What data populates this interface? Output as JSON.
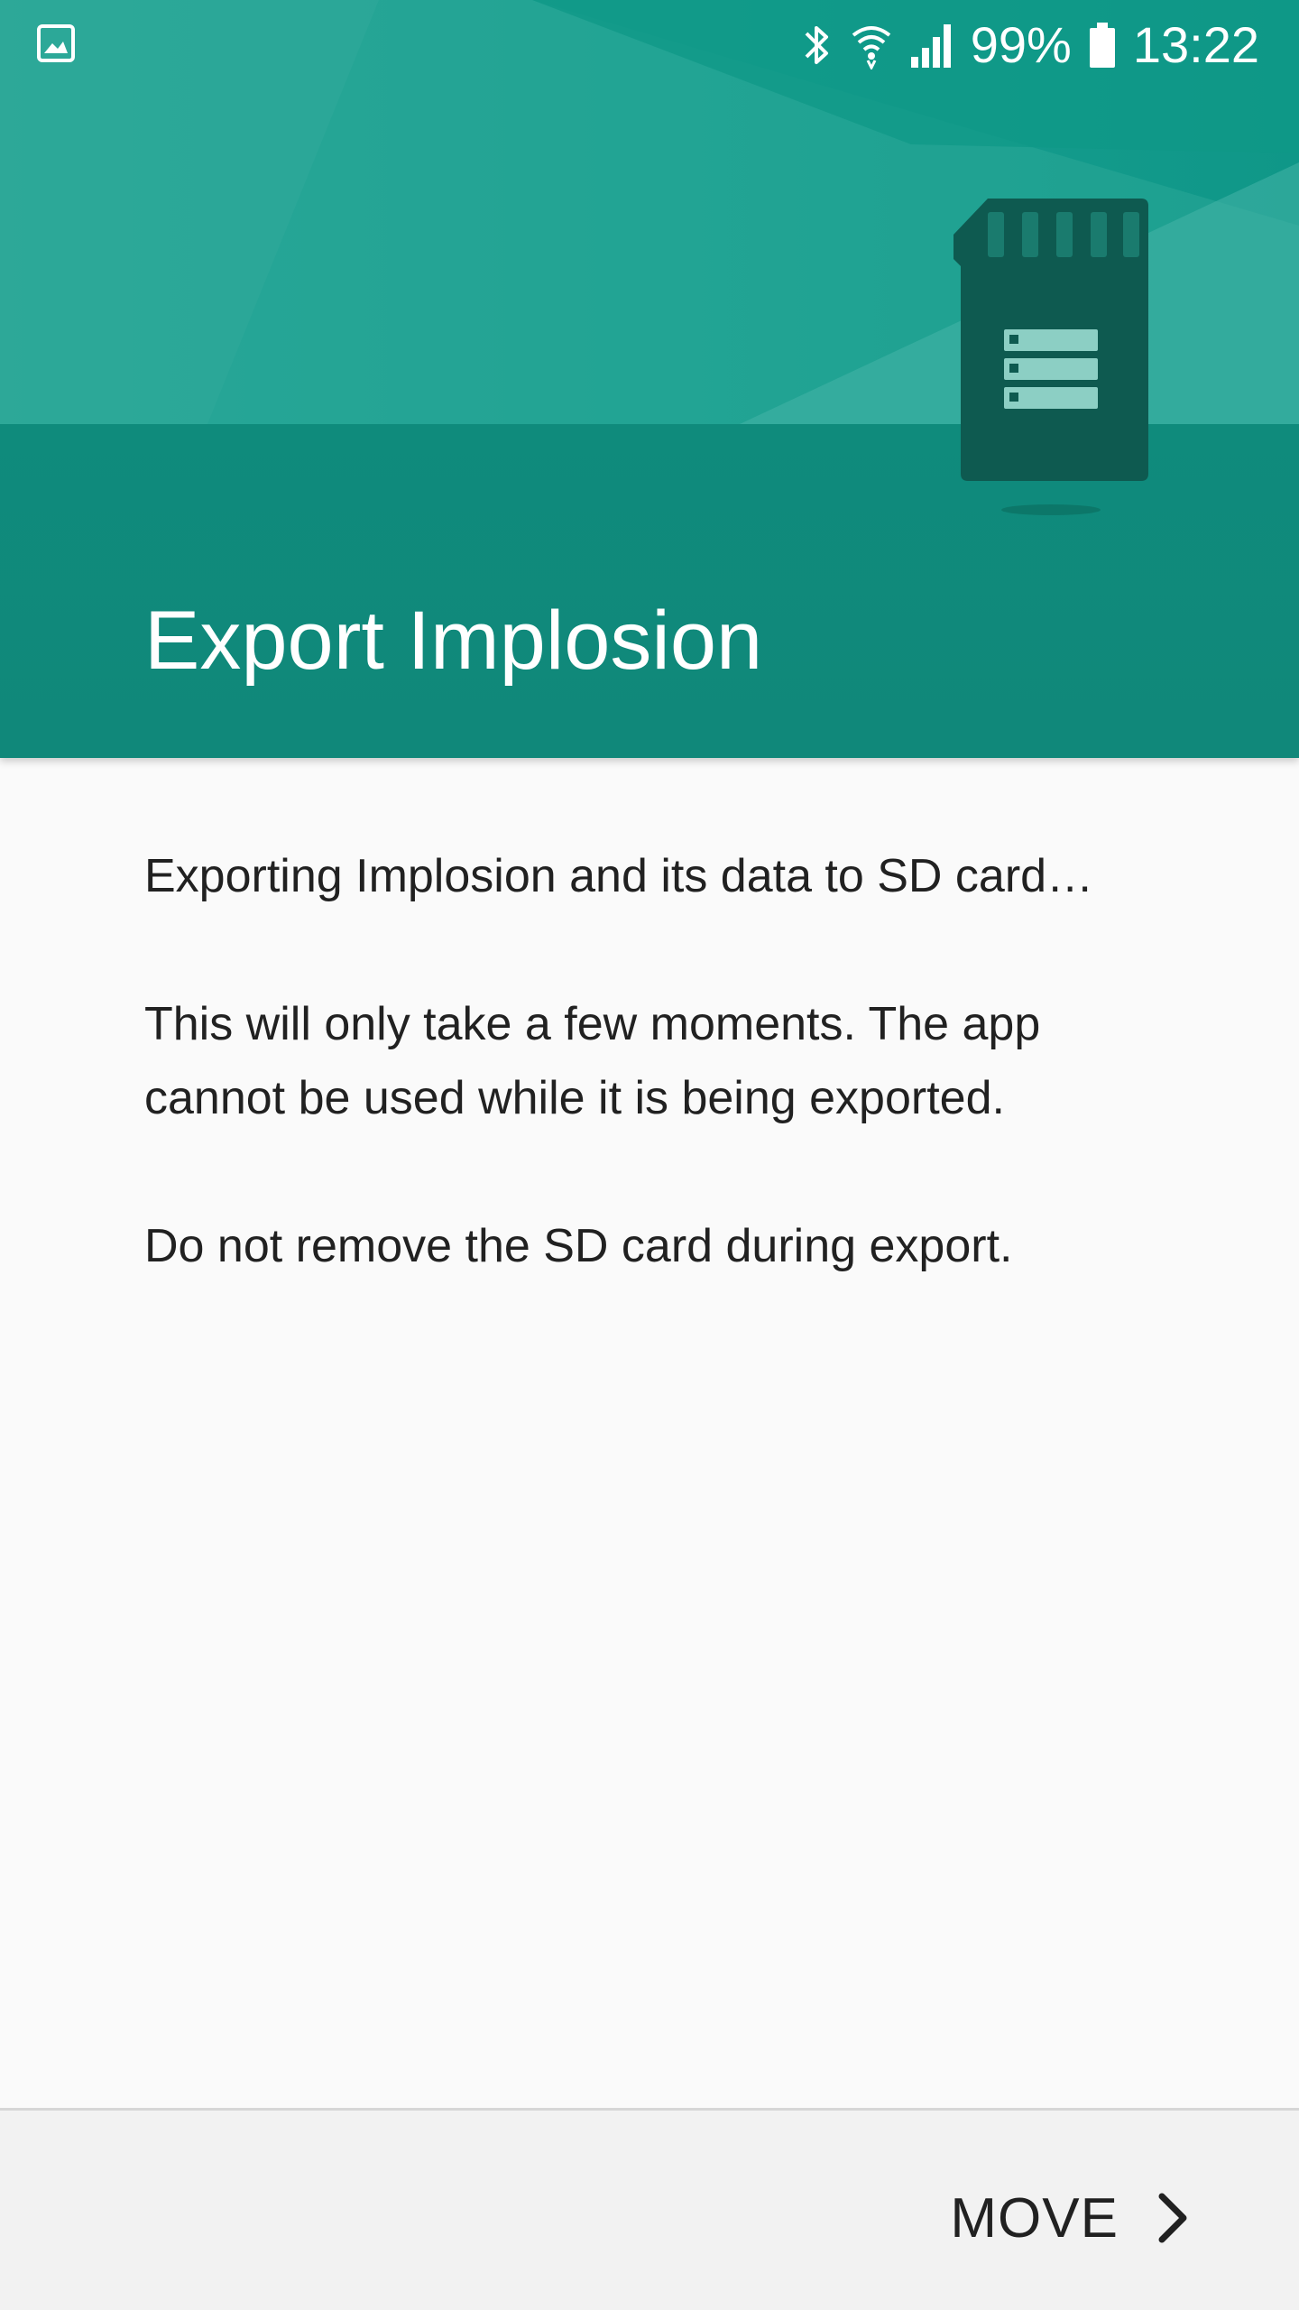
{
  "status_bar": {
    "left_icon": "image-icon",
    "icons": [
      "bluetooth-icon",
      "wifi-icon",
      "signal-icon",
      "battery-icon"
    ],
    "battery": "99%",
    "time": "13:22"
  },
  "header": {
    "title": "Export Implosion",
    "illustration": "sd-card-icon",
    "colors": {
      "teal_light": "#26a596",
      "teal_dark": "#0f8b7c",
      "sd_card": "#0e5a50"
    }
  },
  "body": {
    "paragraphs": [
      "Exporting Implosion and its data to SD card…",
      "This will only take a few moments. The app cannot be used while it is being exported.",
      "Do not remove the SD card during export."
    ]
  },
  "footer": {
    "move_label": "MOVE",
    "move_icon": "chevron-right-icon"
  }
}
